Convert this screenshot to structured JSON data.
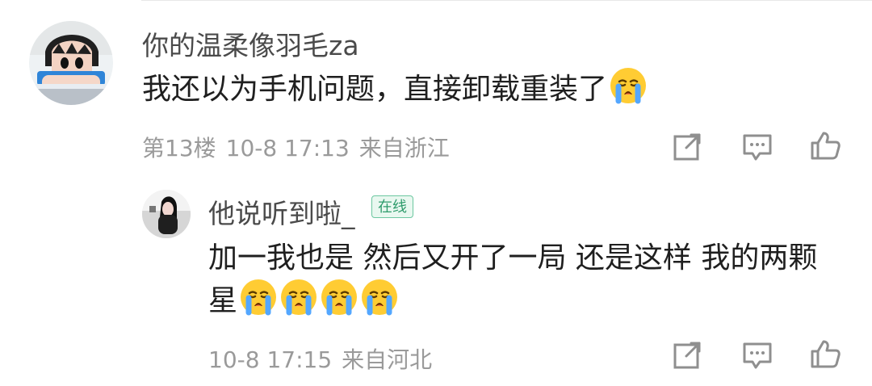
{
  "comment": {
    "username": "你的温柔像羽毛za",
    "text": "我还以为手机问题，直接卸载重装了",
    "floor": "第13楼",
    "time": "10-8 17:13",
    "location": "来自浙江"
  },
  "reply": {
    "username": "他说听到啦_",
    "badge": "在线",
    "text_line_1": "加一我也是 然后又开了一局 还是这样 我的两颗",
    "text_line_2": "星",
    "time": "10-8 17:15",
    "location": "来自河北"
  },
  "icons": {
    "avatar_main": "avatar",
    "avatar_reply": "avatar",
    "emoji": "crying-face-emoji",
    "share": "share-icon",
    "comment": "comment-icon",
    "like": "thumbs-up-icon"
  },
  "colors": {
    "text": "#1f1f1f",
    "secondary_text": "#9a9a9a",
    "badge_text": "#2f9c6c",
    "badge_bg": "#e9f8f0",
    "badge_border": "#6cc7a0"
  }
}
